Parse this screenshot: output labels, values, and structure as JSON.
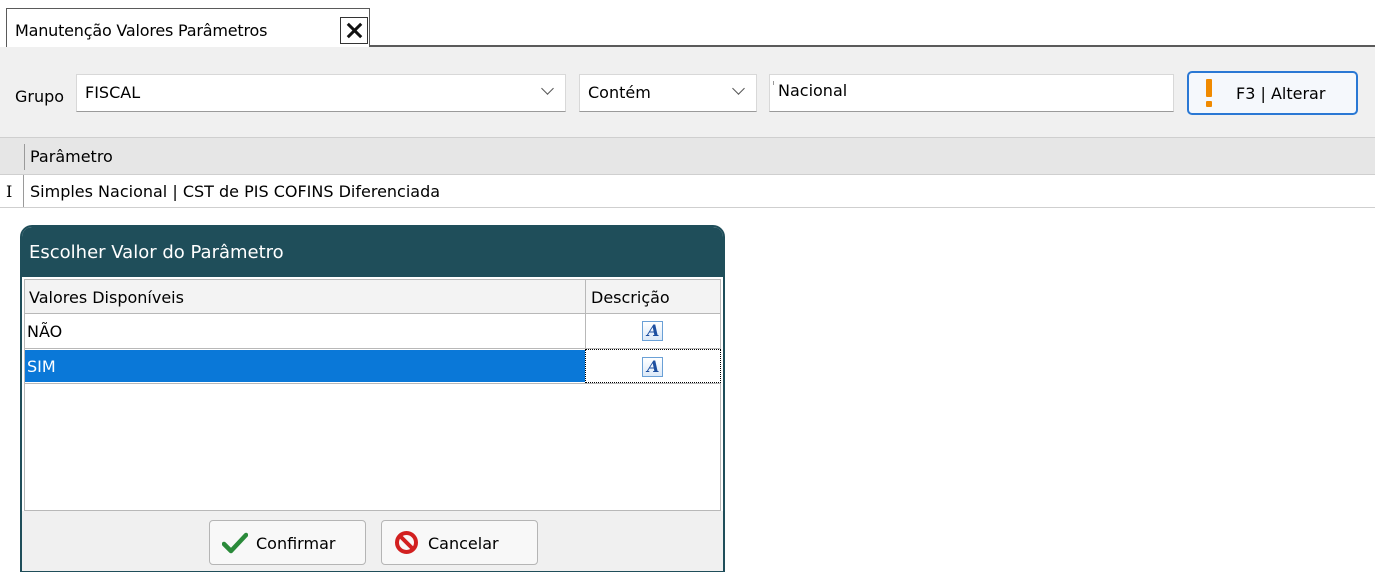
{
  "tab": {
    "title": "Manutenção Valores Parâmetros"
  },
  "filters": {
    "grupo_label": "Grupo",
    "grupo_value": "FISCAL",
    "operator_value": "Contém",
    "search_value": "Nacional",
    "alterar_label": "F3 | Alterar"
  },
  "grid": {
    "header": "Parâmetro",
    "row_indicator": "I",
    "rows": [
      "Simples Nacional | CST de PIS COFINS Diferenciada"
    ]
  },
  "dialog": {
    "title": "Escolher Valor do Parâmetro",
    "col_values": "Valores Disponíveis",
    "col_desc": "Descrição",
    "options": [
      {
        "value": "NÃO",
        "selected": false
      },
      {
        "value": "SIM",
        "selected": true
      }
    ],
    "desc_icon_glyph": "A",
    "confirm_label": "Confirmar",
    "cancel_label": "Cancelar"
  },
  "colors": {
    "dialog_header": "#1f4e5a",
    "selection": "#0a78d8",
    "accent_button_border": "#2a78d4",
    "warning": "#f08a00",
    "confirm_green": "#2a8a3a",
    "cancel_red": "#d22020"
  },
  "icons": {
    "tab_close": "close-icon",
    "dropdown": "chevron-down-icon",
    "alterar": "exclamation-icon",
    "description": "text-document-icon",
    "confirm": "checkmark-icon",
    "cancel": "prohibited-icon"
  }
}
